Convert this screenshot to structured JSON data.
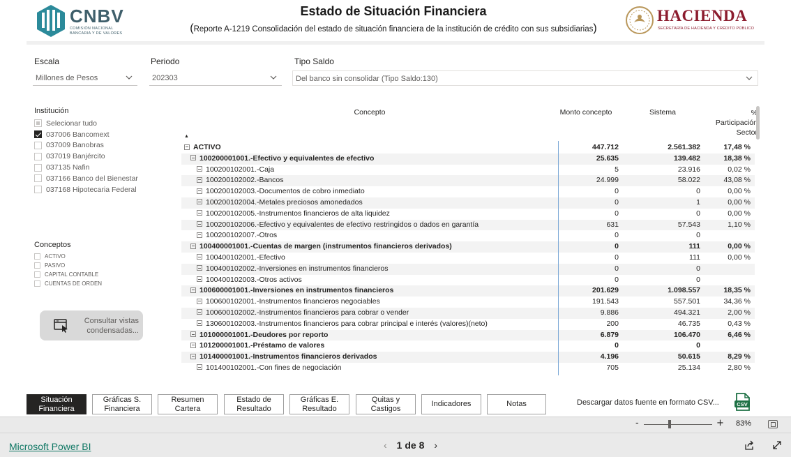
{
  "header": {
    "cnbv_word": "CNBV",
    "cnbv_sub_1": "COMISIÓN NACIONAL",
    "cnbv_sub_2": "BANCARIA Y DE VALORES",
    "title": "Estado de Situación Financiera",
    "subtitle_open": "(",
    "subtitle": "Reporte A-1219 Consolidación del estado de situación financiera de la institución de crédito con sus subsidiarias",
    "subtitle_close": ")",
    "hacienda_word": "HACIENDA",
    "hacienda_sub": "SECRETARÍA DE HACIENDA Y CRÉDITO PÚBLICO",
    "cnbv_color": "#3f5f6b",
    "hacienda_color": "#8c1c2e"
  },
  "filters": {
    "escala_label": "Escala",
    "escala_value": "Millones de Pesos",
    "periodo_label": "Periodo",
    "periodo_value": "202303",
    "tipo_label": "Tipo Saldo",
    "tipo_value": "Del banco sin consolidar (Tipo Saldo:130)"
  },
  "institucion": {
    "title": "Institución",
    "items": [
      {
        "label": "Selecionar tudo",
        "state": "partial"
      },
      {
        "label": "037006 Bancomext",
        "state": "checked"
      },
      {
        "label": "037009 Banobras",
        "state": "unchecked"
      },
      {
        "label": "037019 Banjército",
        "state": "unchecked"
      },
      {
        "label": "037135 Nafin",
        "state": "unchecked"
      },
      {
        "label": "037166 Banco del Bienestar",
        "state": "unchecked"
      },
      {
        "label": "037168 Hipotecaria Federal",
        "state": "unchecked"
      }
    ]
  },
  "conceptos": {
    "title": "Conceptos",
    "items": [
      "ACTIVO",
      "PASIVO",
      "CAPITAL CONTABLE",
      "CUENTAS DE ORDEN"
    ]
  },
  "consult_button": {
    "line1": "Consultar vistas",
    "line2": "condensadas..."
  },
  "table": {
    "headers": {
      "concepto": "Concepto",
      "monto": "Monto concepto",
      "sistema": "Sistema",
      "part_1": "%",
      "part_2": "Participación",
      "part_3": "Sector"
    },
    "sort_indicator": "▲",
    "rows": [
      {
        "concept": "ACTIVO",
        "monto": "447.712",
        "sistema": "2.561.382",
        "part": "17,48 %",
        "level": 0,
        "bold": true
      },
      {
        "concept": "100200001001.-Efectivo y equivalentes de efectivo",
        "monto": "25.635",
        "sistema": "139.482",
        "part": "18,38 %",
        "level": 1,
        "bold": true
      },
      {
        "concept": "100200102001.-Caja",
        "monto": "5",
        "sistema": "23.916",
        "part": "0,02 %",
        "level": 2,
        "bold": false
      },
      {
        "concept": "100200102002.-Bancos",
        "monto": "24.999",
        "sistema": "58.022",
        "part": "43,08 %",
        "level": 2,
        "bold": false
      },
      {
        "concept": "100200102003.-Documentos de cobro inmediato",
        "monto": "0",
        "sistema": "0",
        "part": "0,00 %",
        "level": 2,
        "bold": false
      },
      {
        "concept": "100200102004.-Metales preciosos amonedados",
        "monto": "0",
        "sistema": "1",
        "part": "0,00 %",
        "level": 2,
        "bold": false
      },
      {
        "concept": "100200102005.-Instrumentos financieros de alta liquidez",
        "monto": "0",
        "sistema": "0",
        "part": "0,00 %",
        "level": 2,
        "bold": false
      },
      {
        "concept": "100200102006.-Efectivo y equivalentes de efectivo restringidos o dados en garantía",
        "monto": "631",
        "sistema": "57.543",
        "part": "1,10 %",
        "level": 2,
        "bold": false
      },
      {
        "concept": "100200102007.-Otros",
        "monto": "0",
        "sistema": "0",
        "part": "",
        "level": 2,
        "bold": false
      },
      {
        "concept": "100400001001.-Cuentas de margen (instrumentos financieros derivados)",
        "monto": "0",
        "sistema": "111",
        "part": "0,00 %",
        "level": 1,
        "bold": true
      },
      {
        "concept": "100400102001.-Efectivo",
        "monto": "0",
        "sistema": "111",
        "part": "0,00 %",
        "level": 2,
        "bold": false
      },
      {
        "concept": "100400102002.-Inversiones en instrumentos financieros",
        "monto": "0",
        "sistema": "0",
        "part": "",
        "level": 2,
        "bold": false
      },
      {
        "concept": "100400102003.-Otros activos",
        "monto": "0",
        "sistema": "0",
        "part": "",
        "level": 2,
        "bold": false
      },
      {
        "concept": "100600001001.-Inversiones en instrumentos financieros",
        "monto": "201.629",
        "sistema": "1.098.557",
        "part": "18,35 %",
        "level": 1,
        "bold": true
      },
      {
        "concept": "100600102001.-Instrumentos financieros negociables",
        "monto": "191.543",
        "sistema": "557.501",
        "part": "34,36 %",
        "level": 2,
        "bold": false
      },
      {
        "concept": "100600102002.-Instrumentos financieros para cobrar o vender",
        "monto": "9.886",
        "sistema": "494.321",
        "part": "2,00 %",
        "level": 2,
        "bold": false
      },
      {
        "concept": "130600102003.-Instrumentos financieros para cobrar principal e interés (valores)(neto)",
        "monto": "200",
        "sistema": "46.735",
        "part": "0,43 %",
        "level": 2,
        "bold": false
      },
      {
        "concept": "101000001001.-Deudores por reporto",
        "monto": "6.879",
        "sistema": "106.470",
        "part": "6,46 %",
        "level": 1,
        "bold": true
      },
      {
        "concept": "101200001001.-Préstamo de valores",
        "monto": "0",
        "sistema": "0",
        "part": "",
        "level": 1,
        "bold": true
      },
      {
        "concept": "101400001001.-Instrumentos financieros derivados",
        "monto": "4.196",
        "sistema": "50.615",
        "part": "8,29 %",
        "level": 1,
        "bold": true
      },
      {
        "concept": "101400102001.-Con fines de negociación",
        "monto": "705",
        "sistema": "25.134",
        "part": "2,80 %",
        "level": 2,
        "bold": false
      }
    ]
  },
  "nav_buttons": [
    {
      "label": "Situación\nFinanciera",
      "active": true
    },
    {
      "label": "Gráficas S.\nFinanciera",
      "active": false
    },
    {
      "label": "Resumen Cartera",
      "active": false
    },
    {
      "label": "Estado de\nResultado",
      "active": false
    },
    {
      "label": "Gráficas E.\nResultado",
      "active": false
    },
    {
      "label": "Quitas y Castigos",
      "active": false
    },
    {
      "label": "Indicadores",
      "active": false
    },
    {
      "label": "Notas",
      "active": false
    }
  ],
  "download_text": "Descargar datos fuente en formato CSV...",
  "csv_badge": "CSV",
  "zoom": {
    "minus": "-",
    "plus": "+",
    "percent": "83%",
    "level": 0.38
  },
  "footer": {
    "brand": "Microsoft Power BI",
    "page_indicator": "1 de 8",
    "prev": "‹",
    "next": "›"
  }
}
